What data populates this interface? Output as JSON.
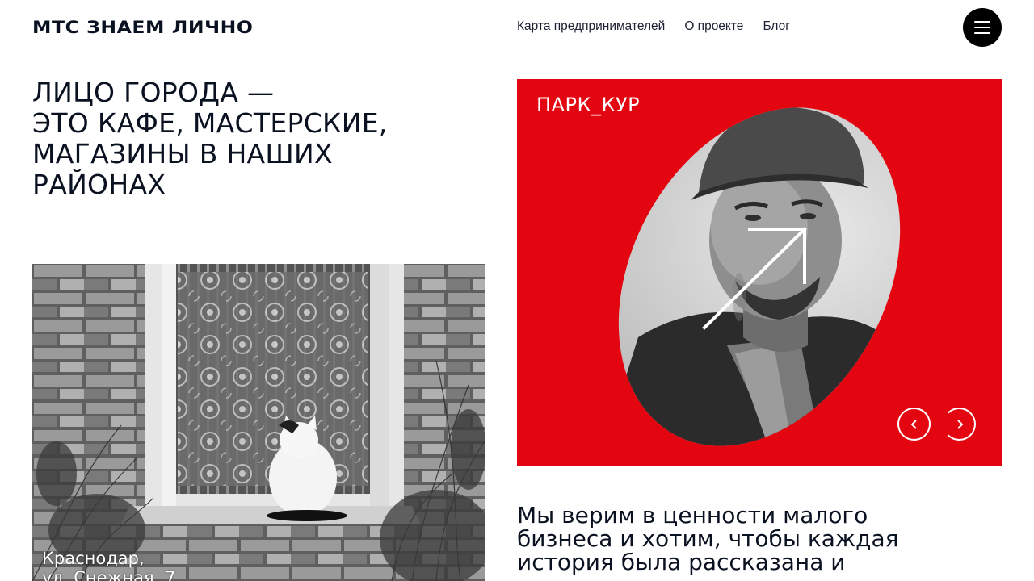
{
  "header": {
    "logo": "МТС ЗНАЕМ ЛИЧНО",
    "nav": [
      {
        "label": "Карта предпринимателей"
      },
      {
        "label": "О проекте"
      },
      {
        "label": "Блог"
      }
    ],
    "menu_icon": "hamburger-icon"
  },
  "hero": {
    "headline_lines": [
      "ЛИЦО ГОРОДА —",
      "ЭТО КАФЕ, МАСТЕРСКИЕ,",
      "МАГАЗИНЫ В НАШИХ",
      "РАЙОНАХ"
    ]
  },
  "photo_card": {
    "caption_lines": [
      "Краснодар,",
      "ул. Снежная, 7"
    ]
  },
  "featured_card": {
    "title": "ПАРК_КУР",
    "background_color": "#e30611",
    "arrow_icon": "arrow-up-right-icon",
    "prev_icon": "chevron-left-icon",
    "next_icon": "chevron-right-icon"
  },
  "mission": {
    "lines": [
      "Мы верим в ценности малого",
      "бизнеса и хотим, чтобы каждая",
      "история была рассказана и"
    ]
  }
}
